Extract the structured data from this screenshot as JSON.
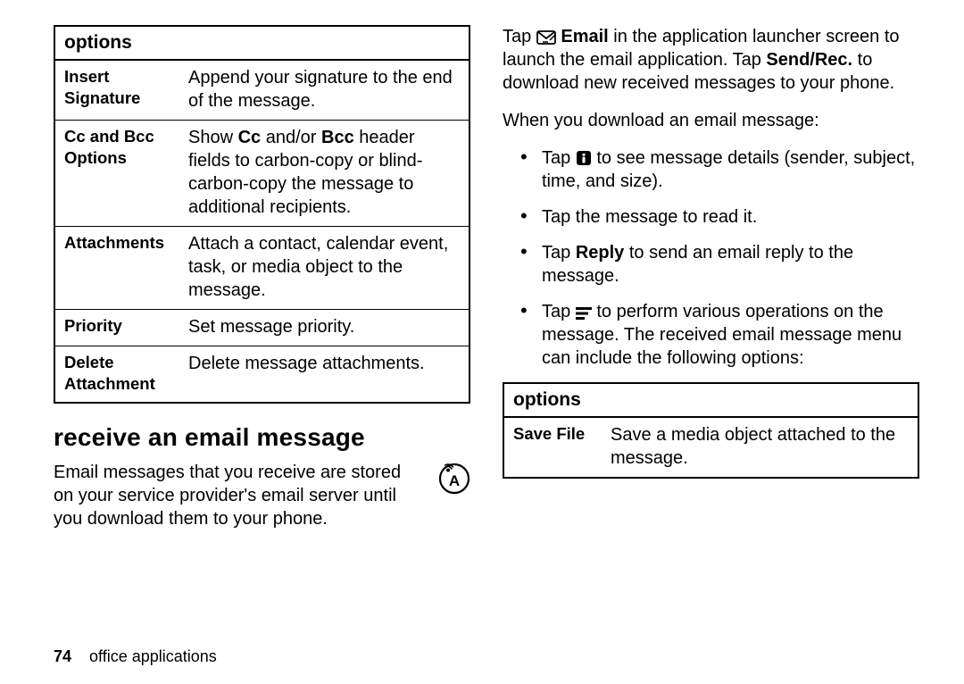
{
  "left_table": {
    "header": "options",
    "rows": [
      {
        "label": "Insert Signature",
        "desc": "Append your signature to the end of the message."
      },
      {
        "label": "Cc and Bcc Options",
        "desc_parts": [
          "Show ",
          "Cc",
          " and/or ",
          "Bcc",
          " header fields to carbon-copy or blind-carbon-copy the message to additional recipients."
        ]
      },
      {
        "label": "Attachments",
        "desc": "Attach a contact, calendar event, task, or media object to the message."
      },
      {
        "label": "Priority",
        "desc": "Set message priority."
      },
      {
        "label": "Delete Attachment",
        "desc": "Delete message attachments."
      }
    ]
  },
  "section_heading": "receive an email message",
  "intro_paragraph": "Email messages that you receive are stored on your service provider's email server until you download them to your phone.",
  "right": {
    "tap_para": {
      "pre": "Tap ",
      "email_label": "Email",
      "mid1": " in the application launcher screen to launch the email application. Tap ",
      "sendrec": "Send/Rec.",
      "mid2": " to download new received messages to your phone."
    },
    "download_line": "When you download an email message:",
    "bullets": {
      "b1_parts": [
        "Tap ",
        " to see message details (sender, subject, time, and size)."
      ],
      "b2": "Tap the message to read it.",
      "b3_parts": [
        "Tap ",
        "Reply",
        " to send an email reply to the message."
      ],
      "b4_parts": [
        "Tap ",
        " to perform various operations on the message. The received email message menu can include the following options:"
      ]
    },
    "table": {
      "header": "options",
      "row": {
        "label": "Save File",
        "desc": "Save a media object attached to the message."
      }
    }
  },
  "footer": {
    "page_number": "74",
    "section_name": "office applications"
  }
}
